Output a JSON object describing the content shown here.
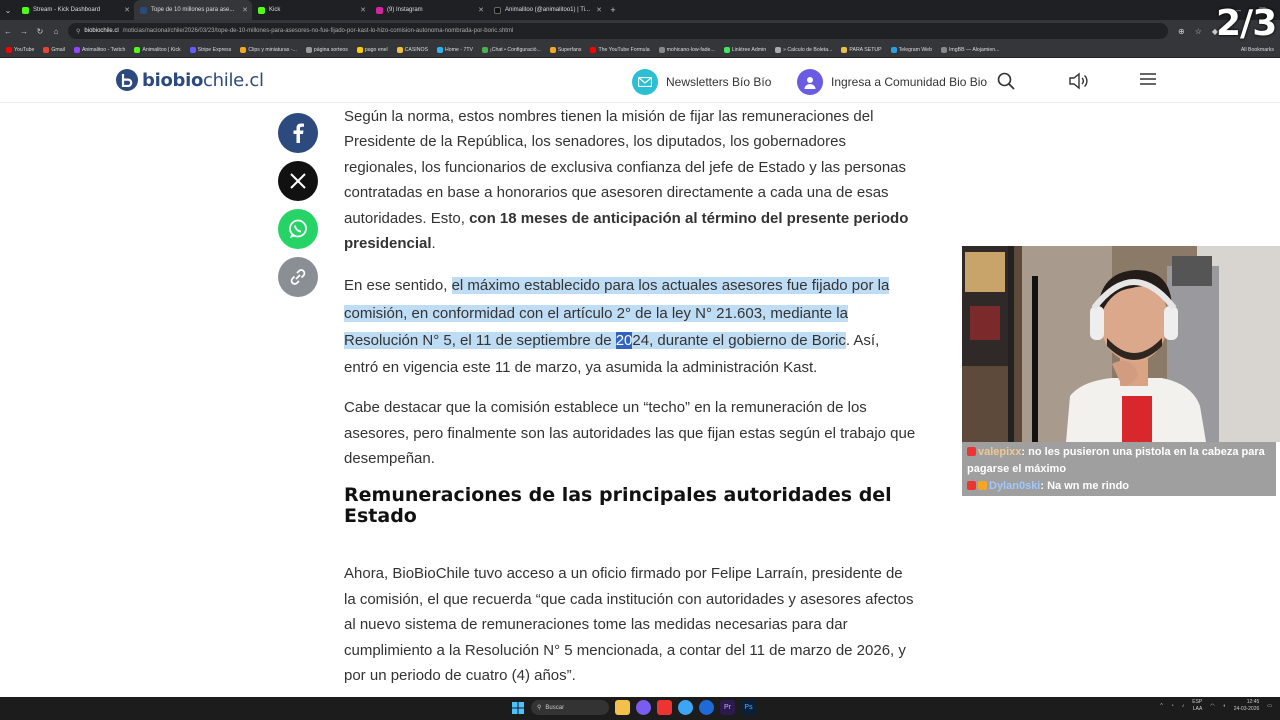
{
  "browser": {
    "tabs": [
      {
        "label": "Stream - Kick Dashboard",
        "color": "#53fc18"
      },
      {
        "label": "Tope de 10 millones para ase...",
        "color": "#2c4a7e",
        "active": true
      },
      {
        "label": "Kick",
        "color": "#53fc18"
      },
      {
        "label": "(9) Instagram",
        "color": "#d6249f"
      },
      {
        "label": "Animalitoo (@animalitoo1) | Ti...",
        "color": "#111111"
      }
    ],
    "url_domain": "biobiochile.cl",
    "url_path": "/noticias/nacional/chile/2026/03/23/tope-de-10-millones-para-asesores-no-fue-fijado-por-kast-lo-hizo-comision-autonoma-nombrada-por-boric.shtml",
    "bookmarks": [
      "YouTube",
      "Gmail",
      "Animalitoo - Twitch",
      "Animalitoo | Kick",
      "Stripe Express",
      "Clips y miniaturas -...",
      "página sorteos",
      "pago enel",
      "CASINOS",
      "Home - 7TV",
      "¡Chat • Configuració...",
      "Superfans",
      "The YouTube Formula",
      "mohicano-low-fade...",
      "Linktree Admin",
      "» Calculo de Boleta...",
      "PARA SETUP",
      "Telegram Web",
      "ImgBB — Alojamien..."
    ],
    "bookmarks_all": "All Bookmarks"
  },
  "overlay_counter": "2/3",
  "site": {
    "logo_bold": "biobio",
    "logo_rest": "chile.cl",
    "newsletters": "Newsletters Bío Bío",
    "comunidad": "Ingresa a Comunidad Bio Bio"
  },
  "article": {
    "p1": "Según la norma, estos nombres tienen la misión de fijar las remuneraciones del Presidente de la República, los senadores, los diputados, los gobernadores regionales, los funcionarios de exclusiva confianza del jefe de Estado y las personas contratadas en base a honorarios que asesoren directamente a cada una de esas autoridades. Esto, ",
    "p1_bold": "con 18 meses de anticipación al término del presente periodo presidencial",
    "p1_end": ".",
    "p2_start": "En ese sentido, ",
    "p2_hl1": "el máximo establecido para los actuales asesores fue fijado por la comisión, en conformidad con el artículo 2° de la ley N° 21.603, mediante la Resolución N° 5, el 11 de septiembre de ",
    "p2_sel": "20",
    "p2_hl2": "24, durante el gobierno de Boric",
    "p2_end": ". Así, entró en vigencia este 11 de marzo, ya asumida la administración Kast.",
    "p3": "Cabe destacar que la comisión establece un “techo” en la remuneración de los asesores, pero finalmente son las autoridades las que fijan estas según el trabajo que desempeñan.",
    "heading": "Remuneraciones de las principales autoridades del Estado",
    "p4": "Ahora, BioBioChile tuvo acceso a un oficio firmado por Felipe Larraín, presidente de la comisión, el que recuerda “que cada institución con autoridades y asesores afectos al nuevo sistema de remuneraciones tome las medidas necesarias para dar cumplimiento a la Resolución N° 5 mencionada, a contar del 11 de marzo de 2026, y por un periodo de cuatro (4) años”."
  },
  "chat": [
    {
      "user": "valepixx",
      "message": "no les pusieron una pistola en la cabeza para pagarse el máximo"
    },
    {
      "user": "Dylan0ski",
      "message": "Na wn me rindo"
    }
  ],
  "taskbar": {
    "search": "Buscar",
    "lang": "ESP",
    "lang2": "LAA",
    "time": "12:45",
    "date": "24-03-2026"
  }
}
